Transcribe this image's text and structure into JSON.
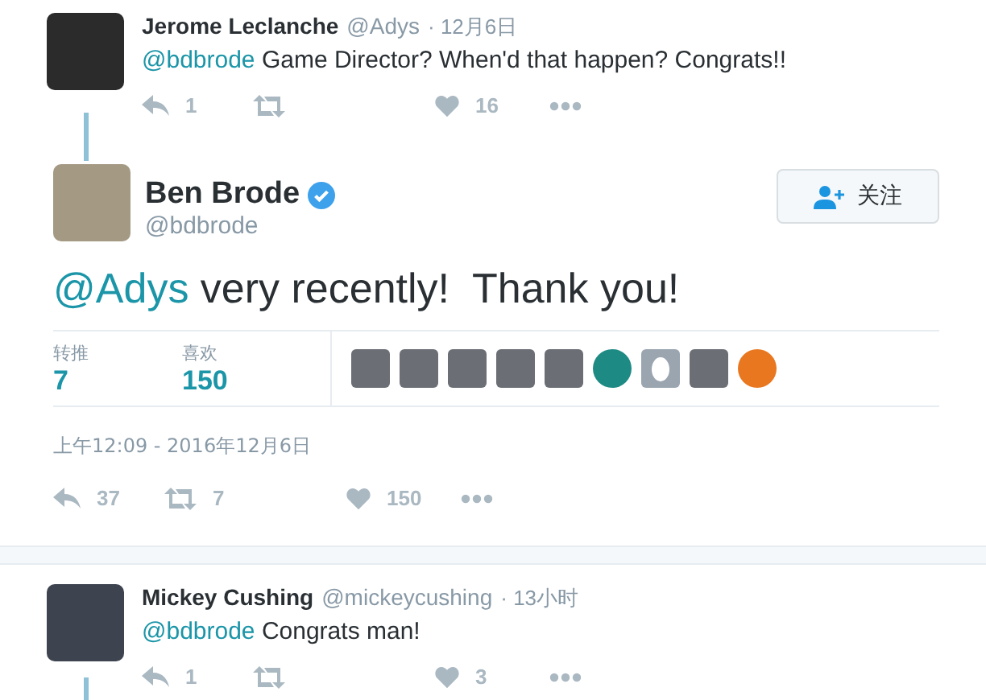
{
  "reply_parent": {
    "name": "Jerome Leclanche",
    "handle": "@Adys",
    "time": "· 12月6日",
    "mention": "@bdbrode",
    "text": " Game Director? When'd that happen? Congrats!!",
    "actions": [
      {
        "kind": "reply",
        "count": "1"
      },
      {
        "kind": "retweet"
      },
      {
        "kind": "like",
        "count": "16"
      },
      {
        "kind": "more"
      }
    ]
  },
  "main_tweet": {
    "name": "Ben Brode",
    "verified": true,
    "handle": "@bdbrode",
    "follow_button": "关注",
    "mention": "@Adys",
    "text": " very recently!  Thank you!",
    "stats": [
      {
        "label": "转推",
        "value": "7"
      },
      {
        "label": "喜欢",
        "value": "150"
      }
    ],
    "likers": [
      {
        "kind": "photo"
      },
      {
        "kind": "photo"
      },
      {
        "kind": "photo"
      },
      {
        "kind": "photo"
      },
      {
        "kind": "photo"
      },
      {
        "kind": "logo"
      },
      {
        "kind": "egg"
      },
      {
        "kind": "photo"
      },
      {
        "kind": "logo"
      }
    ],
    "timestamp": "上午12:09 - 2016年12月6日",
    "actions": [
      {
        "kind": "reply",
        "count": "37"
      },
      {
        "kind": "retweet",
        "count": "7"
      },
      {
        "kind": "like",
        "count": "150"
      },
      {
        "kind": "more"
      }
    ]
  },
  "replies": [
    {
      "name": "Mickey Cushing",
      "handle": "@mickeycushing",
      "time": "· 13小时",
      "mention": "@bdbrode",
      "text": " Congrats man!",
      "actions": [
        {
          "kind": "reply",
          "count": "1"
        },
        {
          "kind": "retweet"
        },
        {
          "kind": "like",
          "count": "3"
        },
        {
          "kind": "more"
        }
      ]
    }
  ]
}
